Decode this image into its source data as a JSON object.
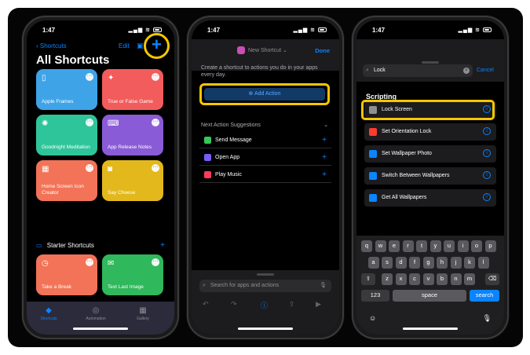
{
  "colors": {
    "accent": "#0a84ff",
    "highlight": "#f7c600",
    "background": "#050505"
  },
  "phone1": {
    "time": "1:47",
    "nav": {
      "back_label": "Shortcuts",
      "edit_label": "Edit",
      "add_icon": "plus-icon"
    },
    "title": "All Shortcuts",
    "tiles": [
      {
        "label": "Apple Frames",
        "color": "#3fa3e8",
        "icon": "phone-icon"
      },
      {
        "label": "True or False Game",
        "color": "#f25c5c",
        "icon": "sparkle-icon"
      },
      {
        "label": "Goodnight Meditation",
        "color": "#2fc59a",
        "icon": "sun-icon"
      },
      {
        "label": "App Release Notes",
        "color": "#8a5bd6",
        "icon": "keyboard-icon"
      },
      {
        "label": "Home Screen Icon Creator",
        "color": "#f27357",
        "icon": "grid-icon"
      },
      {
        "label": "Say Cheese",
        "color": "#e3b81c",
        "icon": "camera-icon"
      },
      {
        "label": "Take a Break",
        "color": "#f27357",
        "icon": "clock-icon"
      },
      {
        "label": "Text Last Image",
        "color": "#2fb85c",
        "icon": "message-icon"
      }
    ],
    "section": {
      "label": "Starter Shortcuts"
    },
    "tabs": [
      {
        "label": "Shortcuts"
      },
      {
        "label": "Automation"
      },
      {
        "label": "Gallery"
      }
    ]
  },
  "phone2": {
    "time": "1:47",
    "shortcut_name": "New Shortcut",
    "done_label": "Done",
    "description": "Create a shortcut to actions you do in your apps every day.",
    "add_action_label": "Add Action",
    "next_header": "Next Action Suggestions",
    "suggestions": [
      {
        "label": "Send Message",
        "color": "#34c759"
      },
      {
        "label": "Open App",
        "color": "#7a5af8"
      },
      {
        "label": "Play Music",
        "color": "#ff3b5c"
      }
    ],
    "search_placeholder": "Search for apps and actions"
  },
  "phone3": {
    "time": "1:47",
    "search_value": "Lock",
    "cancel_label": "Cancel",
    "section_label": "Scripting",
    "results": [
      {
        "label": "Lock Screen",
        "color": "#8e8e93"
      },
      {
        "label": "Set Orientation Lock",
        "color": "#ff3b30"
      },
      {
        "label": "Set Wallpaper Photo",
        "color": "#0a84ff"
      },
      {
        "label": "Switch Between Wallpapers",
        "color": "#0a84ff"
      },
      {
        "label": "Get All Wallpapers",
        "color": "#0a84ff"
      }
    ],
    "keyboard": {
      "row1": [
        "q",
        "w",
        "e",
        "r",
        "t",
        "y",
        "u",
        "i",
        "o",
        "p"
      ],
      "row2": [
        "a",
        "s",
        "d",
        "f",
        "g",
        "h",
        "j",
        "k",
        "l"
      ],
      "row3": [
        "z",
        "x",
        "c",
        "v",
        "b",
        "n",
        "m"
      ],
      "num_label": "123",
      "space_label": "space",
      "search_label": "search"
    }
  }
}
